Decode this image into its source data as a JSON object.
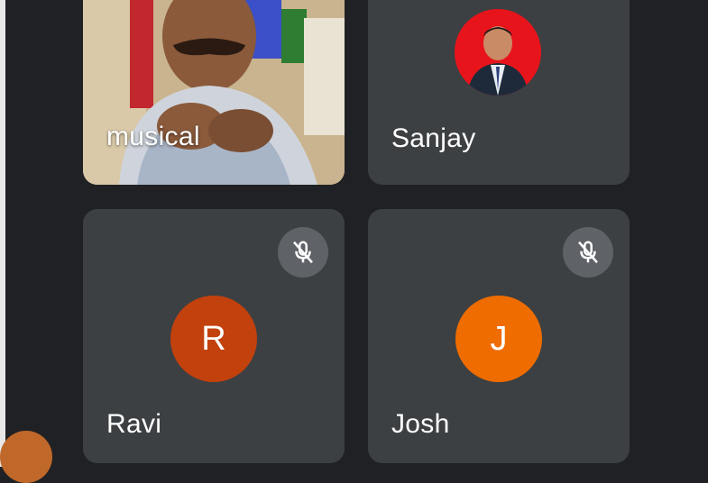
{
  "participants": [
    {
      "name": "musical",
      "type": "video"
    },
    {
      "name": "Sanjay",
      "type": "photo"
    },
    {
      "name": "Ravi",
      "initial": "R",
      "avatar_color": "#c2410c",
      "muted": true
    },
    {
      "name": "Josh",
      "initial": "J",
      "avatar_color": "#ef6c00",
      "muted": true
    }
  ],
  "colors": {
    "background": "#202124",
    "tile": "#3c4043",
    "mute_badge": "#5f6368"
  },
  "icons": {
    "mute": "mic-off-icon"
  }
}
